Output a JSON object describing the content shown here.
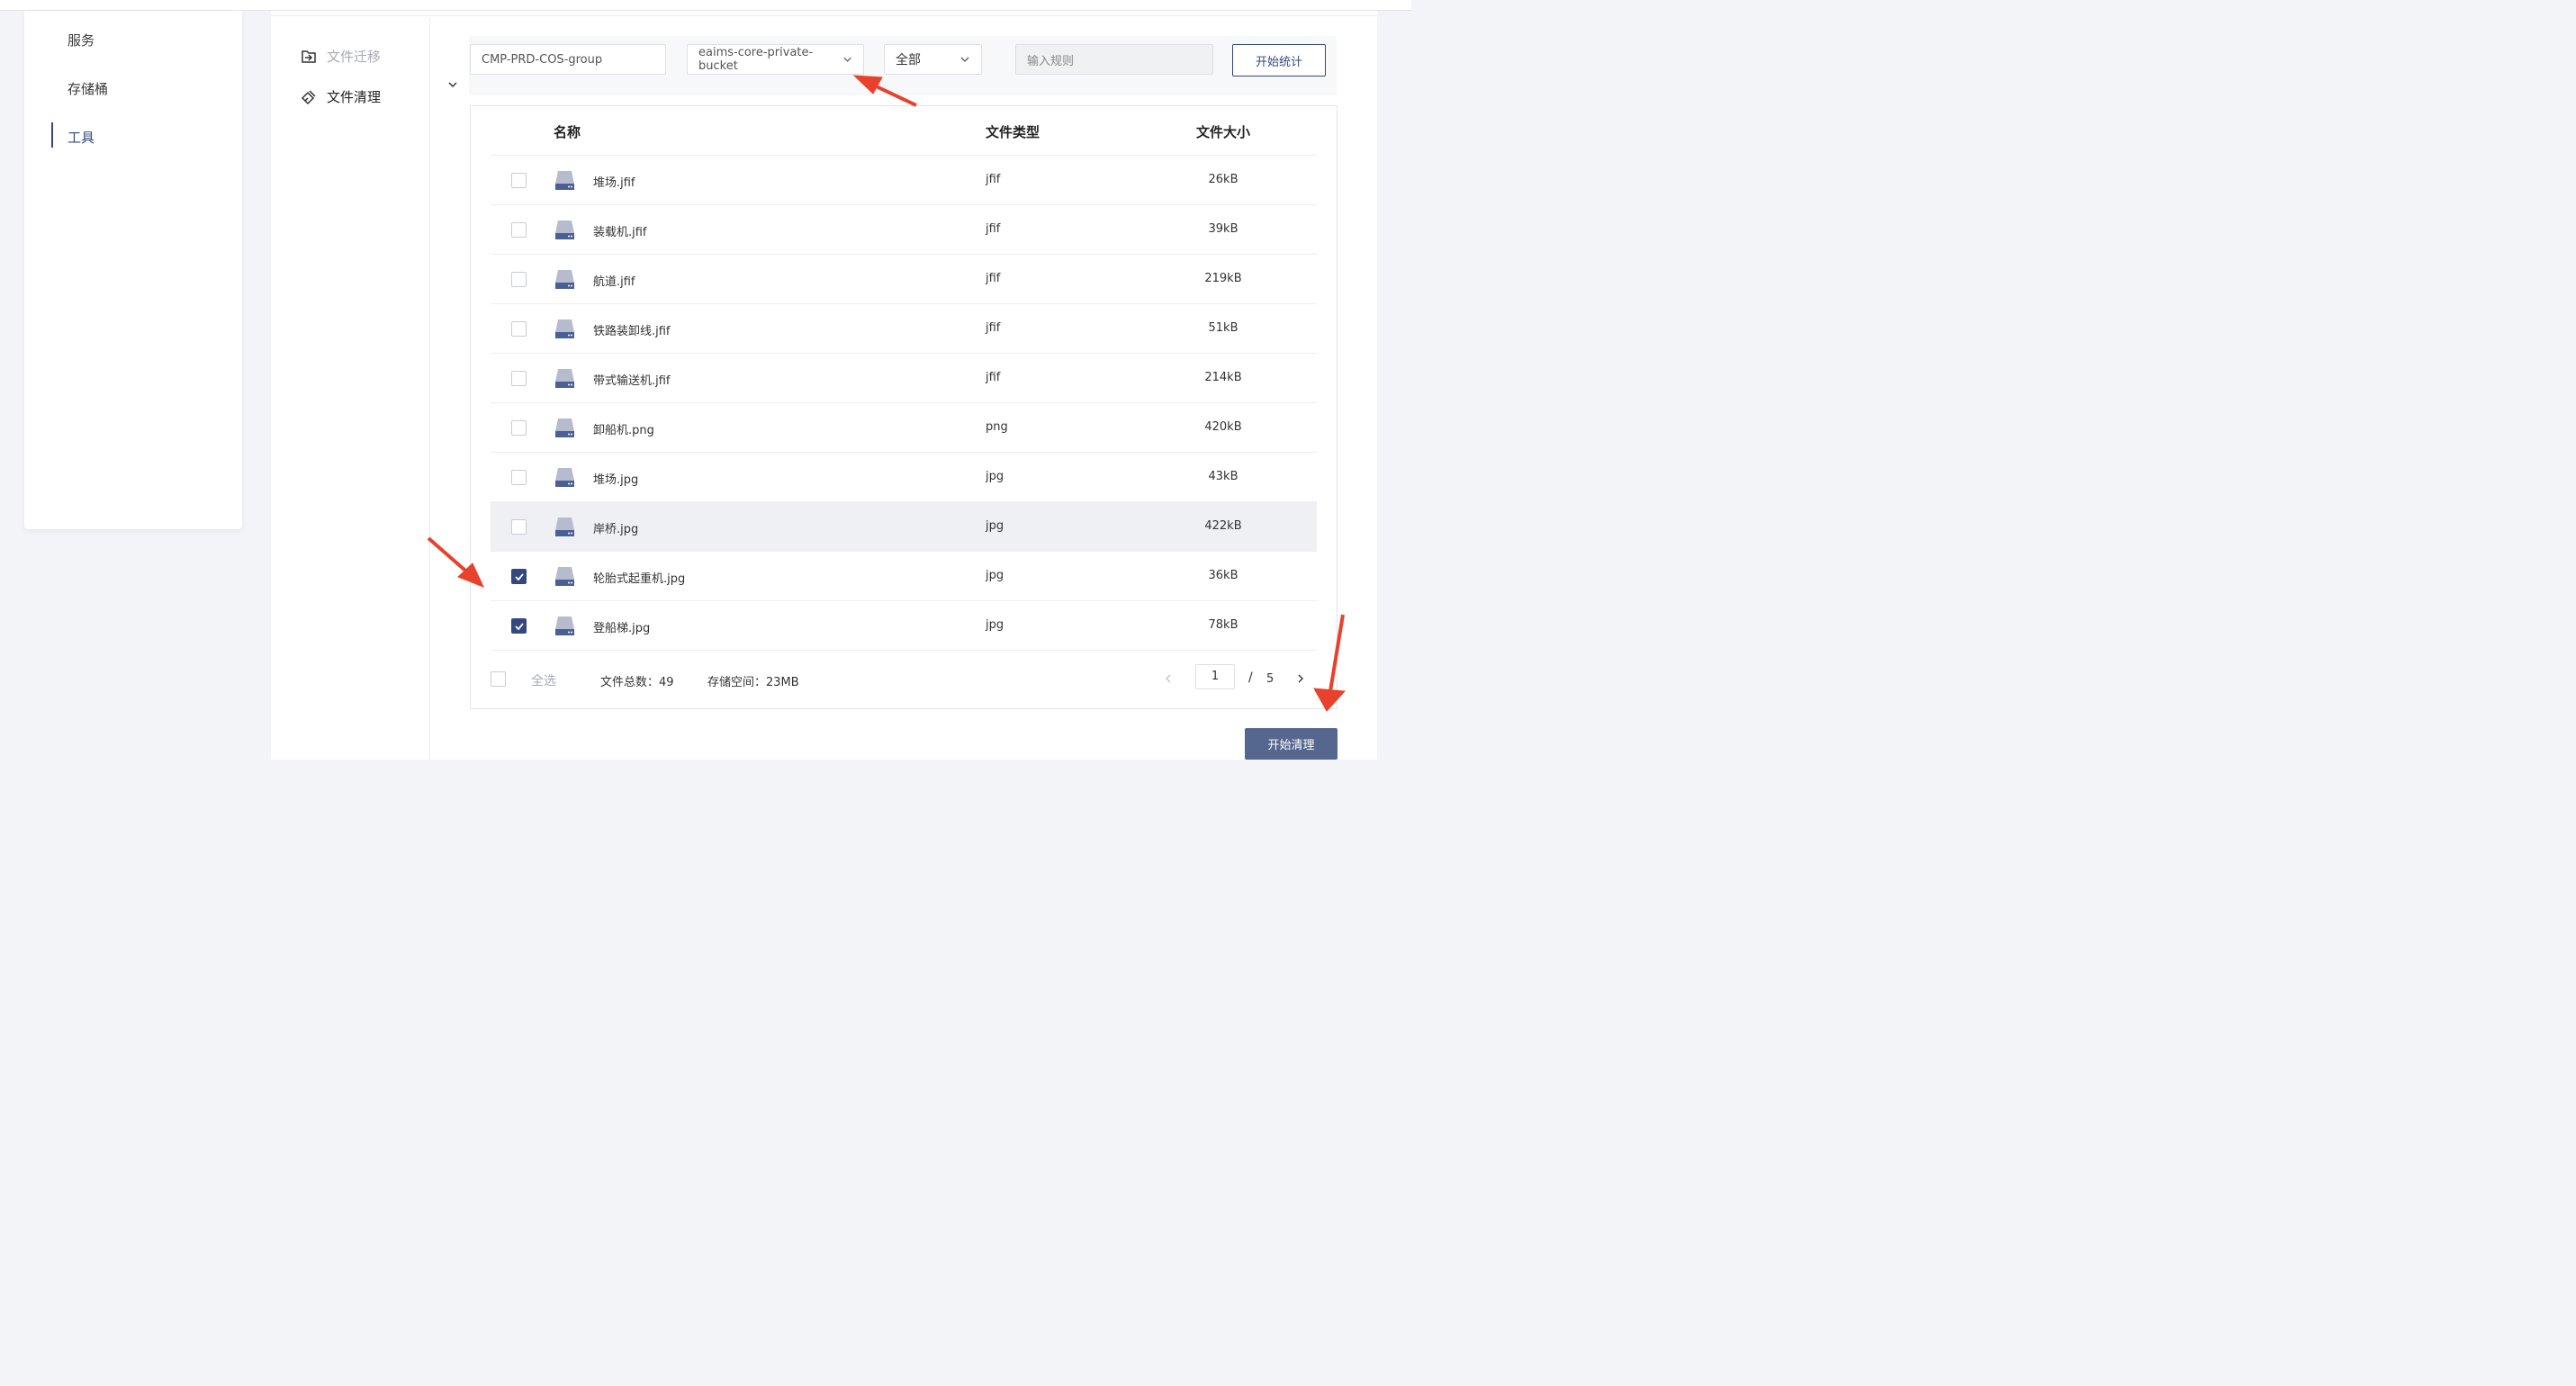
{
  "sidebar": {
    "items": [
      {
        "label": "服务"
      },
      {
        "label": "存储桶"
      },
      {
        "label": "工具"
      }
    ],
    "active_index": 2
  },
  "subnav": {
    "items": [
      {
        "label": "文件迁移",
        "icon": "file-transfer-icon"
      },
      {
        "label": "文件清理",
        "icon": "broom-icon"
      }
    ],
    "active_index": 1
  },
  "filters": {
    "group_value": "CMP-PRD-COS-group",
    "bucket_value": "eaims-core-private-bucket",
    "scope_value": "全部",
    "rule_placeholder": "输入规则",
    "stat_button": "开始统计"
  },
  "table": {
    "columns": [
      "名称",
      "文件类型",
      "文件大小"
    ],
    "rows": [
      {
        "name": "堆场.jfif",
        "type": "jfif",
        "size": "26kB",
        "checked": false
      },
      {
        "name": "装载机.jfif",
        "type": "jfif",
        "size": "39kB",
        "checked": false
      },
      {
        "name": "航道.jfif",
        "type": "jfif",
        "size": "219kB",
        "checked": false
      },
      {
        "name": "铁路装卸线.jfif",
        "type": "jfif",
        "size": "51kB",
        "checked": false
      },
      {
        "name": "带式输送机.jfif",
        "type": "jfif",
        "size": "214kB",
        "checked": false
      },
      {
        "name": "卸船机.png",
        "type": "png",
        "size": "420kB",
        "checked": false
      },
      {
        "name": "堆场.jpg",
        "type": "jpg",
        "size": "43kB",
        "checked": false
      },
      {
        "name": "岸桥.jpg",
        "type": "jpg",
        "size": "422kB",
        "checked": false
      },
      {
        "name": "轮胎式起重机.jpg",
        "type": "jpg",
        "size": "36kB",
        "checked": true
      },
      {
        "name": "登船梯.jpg",
        "type": "jpg",
        "size": "78kB",
        "checked": true
      }
    ],
    "hover_row_index": 7
  },
  "footer": {
    "select_all": "全选",
    "total_files": "文件总数：49",
    "storage": "存储空间：23MB",
    "page_current": "1",
    "page_slash": "/",
    "page_total": "5"
  },
  "actions": {
    "clean_button": "开始清理"
  },
  "colors": {
    "primary": "#34487e",
    "clean_button": "#56678f",
    "annotation_arrow": "#e8412c"
  }
}
